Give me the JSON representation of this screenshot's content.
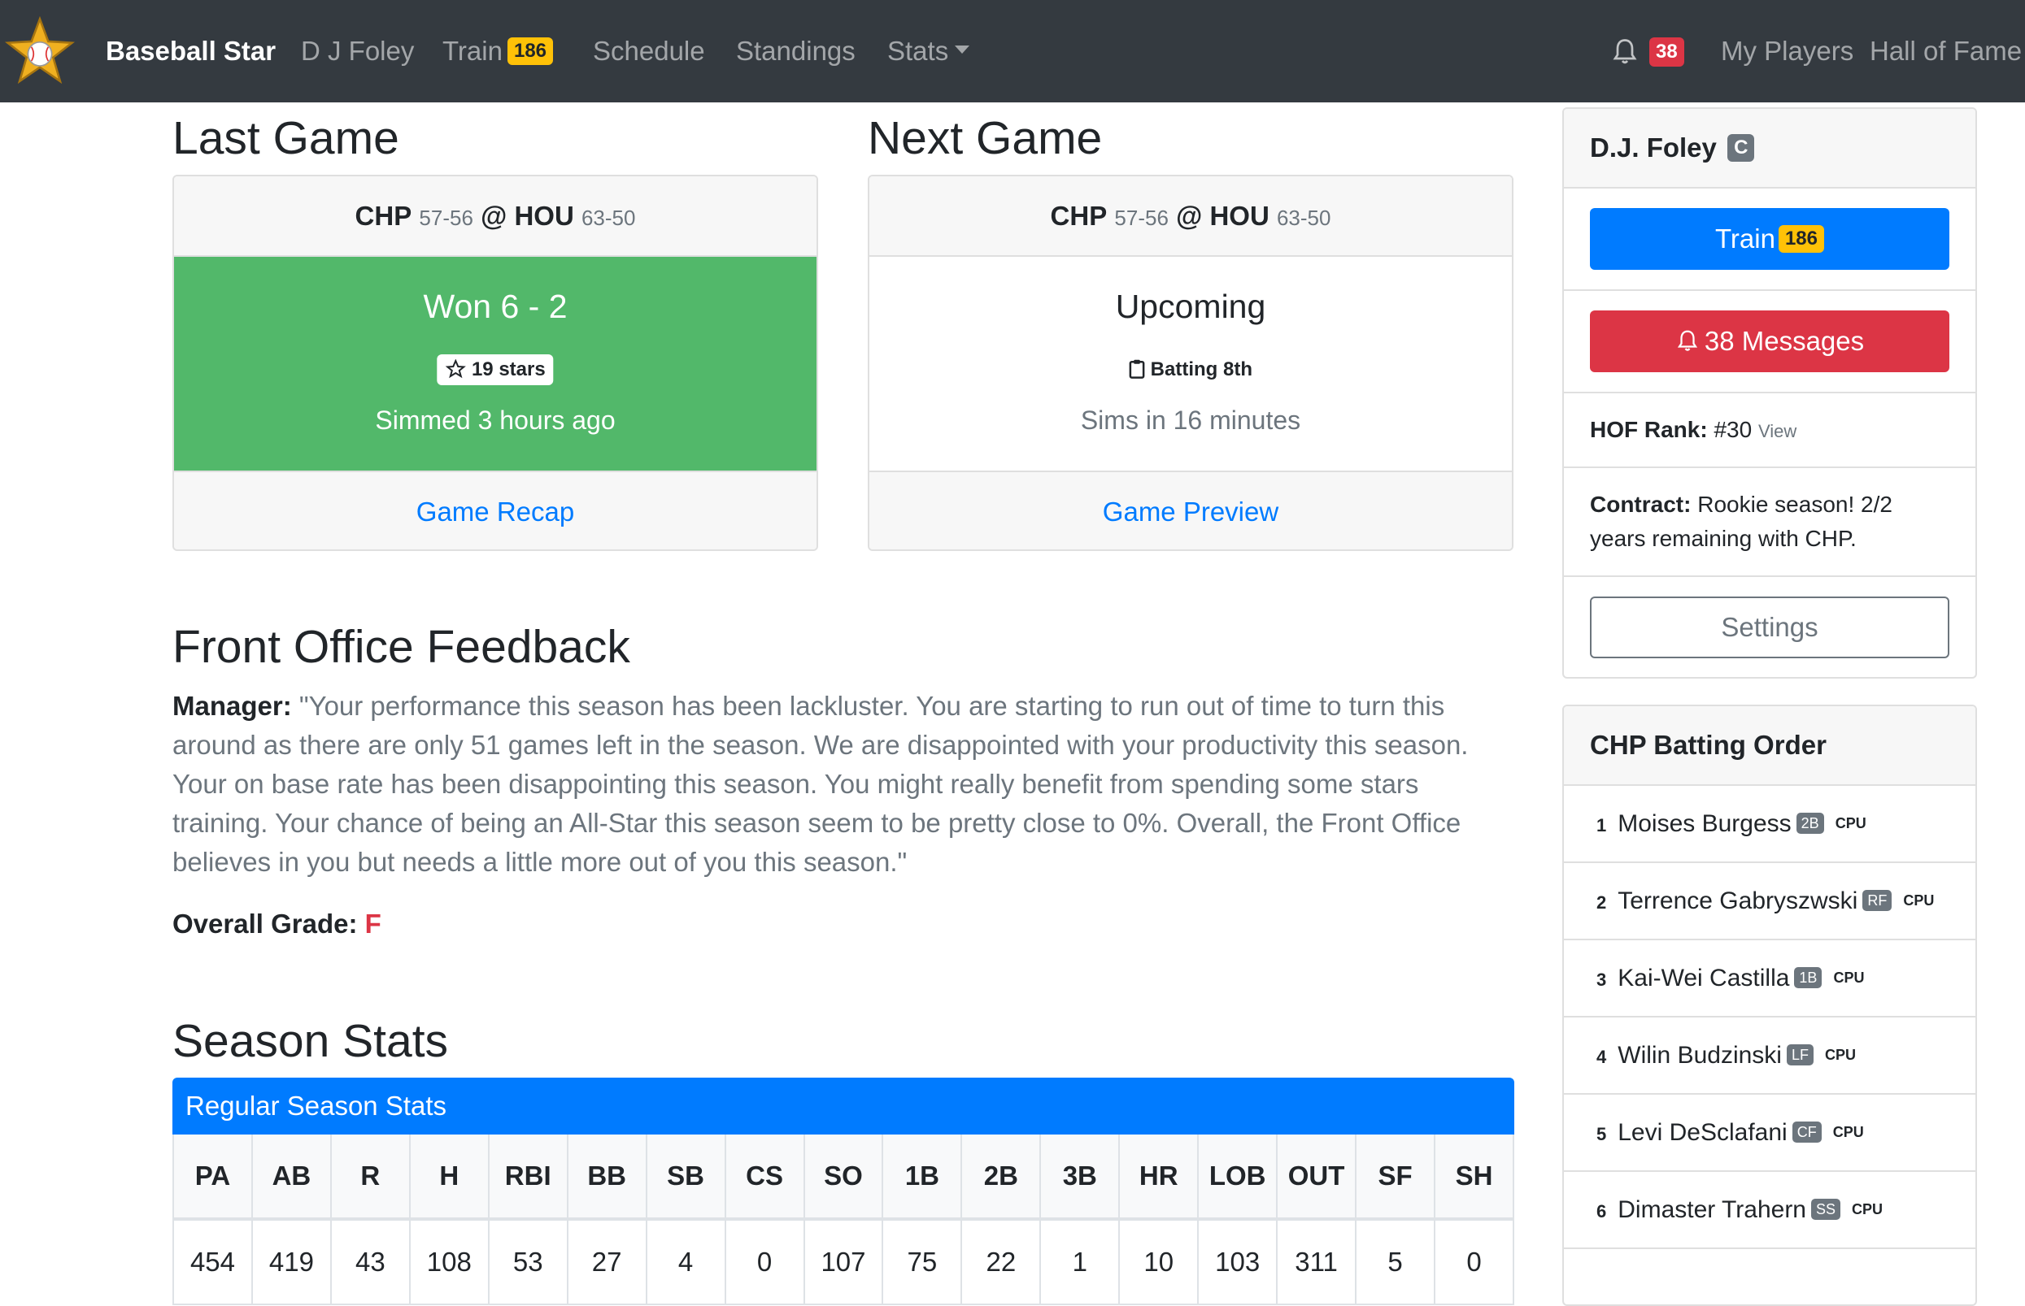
{
  "nav": {
    "brand": "Baseball Star",
    "player_link": "D J Foley",
    "train_label": "Train",
    "train_badge": "186",
    "schedule": "Schedule",
    "standings": "Standings",
    "stats": "Stats",
    "notifications_badge": "38",
    "my_players": "My Players",
    "hall_of_fame": "Hall of Fame"
  },
  "last_game": {
    "heading": "Last Game",
    "away_team": "CHP",
    "away_record": "57-56",
    "at": "@",
    "home_team": "HOU",
    "home_record": "63-50",
    "result": "Won 6 - 2",
    "stars": "19 stars",
    "simmed": "Simmed 3 hours ago",
    "link": "Game Recap"
  },
  "next_game": {
    "heading": "Next Game",
    "away_team": "CHP",
    "away_record": "57-56",
    "at": "@",
    "home_team": "HOU",
    "home_record": "63-50",
    "status": "Upcoming",
    "batting": "Batting 8th",
    "sims_in": "Sims in 16 minutes",
    "link": "Game Preview"
  },
  "feedback": {
    "heading": "Front Office Feedback",
    "manager_label": "Manager:",
    "manager_text": "\"Your performance this season has been lackluster. You are starting to run out of time to turn this around as there are only 51 games left in the season. We are disappointed with your productivity this season. Your on base rate has been disappointing this season. You might really benefit from spending some stars training. Your chance of being an All-Star this season seem to be pretty close to 0%. Overall, the Front Office believes in you but needs a little more out of you this season.\"",
    "grade_label": "Overall Grade:",
    "grade": "F"
  },
  "season_stats": {
    "heading": "Season Stats",
    "table_title": "Regular Season Stats",
    "columns": [
      "PA",
      "AB",
      "R",
      "H",
      "RBI",
      "BB",
      "SB",
      "CS",
      "SO",
      "1B",
      "2B",
      "3B",
      "HR",
      "LOB",
      "OUT",
      "SF",
      "SH"
    ],
    "values": [
      "454",
      "419",
      "43",
      "108",
      "53",
      "27",
      "4",
      "0",
      "107",
      "75",
      "22",
      "1",
      "10",
      "103",
      "311",
      "5",
      "0"
    ]
  },
  "player_card": {
    "name": "D.J. Foley",
    "position": "C",
    "train_label": "Train",
    "train_badge": "186",
    "messages_label": "38 Messages",
    "hof_label": "HOF Rank:",
    "hof_value": "#30",
    "hof_view": "View",
    "contract_label": "Contract:",
    "contract_text": "Rookie season! 2/2 years remaining with CHP.",
    "settings_label": "Settings"
  },
  "batting_order": {
    "heading": "CHP Batting Order",
    "players": [
      {
        "num": "1",
        "name": "Moises Burgess",
        "pos": "2B",
        "tag": "CPU"
      },
      {
        "num": "2",
        "name": "Terrence Gabryszwski",
        "pos": "RF",
        "tag": "CPU"
      },
      {
        "num": "3",
        "name": "Kai-Wei Castilla",
        "pos": "1B",
        "tag": "CPU"
      },
      {
        "num": "4",
        "name": "Wilin Budzinski",
        "pos": "LF",
        "tag": "CPU"
      },
      {
        "num": "5",
        "name": "Levi DeSclafani",
        "pos": "CF",
        "tag": "CPU"
      },
      {
        "num": "6",
        "name": "Dimaster Trahern",
        "pos": "SS",
        "tag": "CPU"
      }
    ]
  },
  "colors": {
    "navbar": "#343a40",
    "primary": "#007bff",
    "success": "#52b86a",
    "danger": "#dc3545",
    "warning": "#ffc107"
  }
}
